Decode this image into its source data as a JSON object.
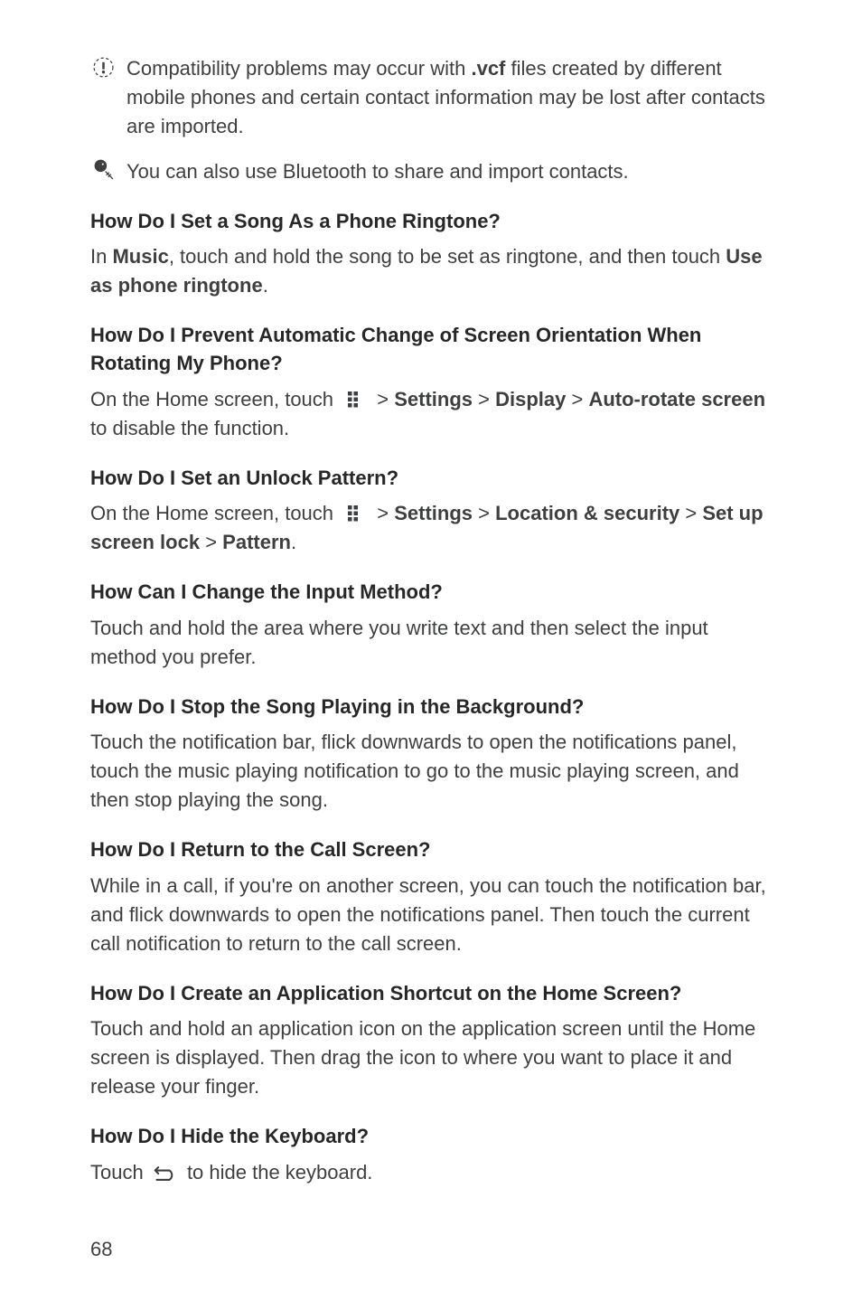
{
  "callouts": {
    "warning": {
      "pre": "Compatibility problems may occur with ",
      "vcf": ".vcf",
      "post": " files created by different mobile phones and certain contact information may be lost after contacts are imported."
    },
    "tip": {
      "text": "You can also use Bluetooth to share and import contacts."
    }
  },
  "sections": [
    {
      "title": "How Do I Set a Song As a Phone Ringtone?",
      "parts": [
        {
          "text": "In "
        },
        {
          "text": "Music",
          "bold": true
        },
        {
          "text": ", touch and hold the song to be set as ringtone, and then touch "
        },
        {
          "text": "Use as phone ringtone",
          "bold": true
        },
        {
          "text": "."
        }
      ]
    },
    {
      "title": "How Do I Prevent Automatic Change of Screen Orientation When Rotating My Phone?",
      "parts": [
        {
          "text": "On the Home screen, touch "
        },
        {
          "icon": "apps"
        },
        {
          "text": " > "
        },
        {
          "text": "Settings",
          "bold": true
        },
        {
          "text": " > "
        },
        {
          "text": "Display",
          "bold": true
        },
        {
          "text": " > "
        },
        {
          "text": "Auto-rotate screen",
          "bold": true
        },
        {
          "text": " to disable the function."
        }
      ]
    },
    {
      "title": "How Do I Set an Unlock Pattern?",
      "parts": [
        {
          "text": "On the Home screen, touch "
        },
        {
          "icon": "apps"
        },
        {
          "text": " > "
        },
        {
          "text": "Settings",
          "bold": true
        },
        {
          "text": " > "
        },
        {
          "text": "Location & security",
          "bold": true
        },
        {
          "text": " > "
        },
        {
          "text": "Set up screen lock",
          "bold": true
        },
        {
          "text": " > "
        },
        {
          "text": "Pattern",
          "bold": true
        },
        {
          "text": "."
        }
      ]
    },
    {
      "title": "How Can I Change the Input Method?",
      "parts": [
        {
          "text": "Touch and hold the area where you write text and then select the input method you prefer."
        }
      ]
    },
    {
      "title": "How Do I Stop the Song Playing in the Background?",
      "parts": [
        {
          "text": "Touch the notification bar, flick downwards to open the notifications panel, touch the music playing notification to go to the music playing screen, and then stop playing the song."
        }
      ]
    },
    {
      "title": "How Do I Return to the Call Screen?",
      "parts": [
        {
          "text": "While in a call, if you're on another screen, you can touch the notification bar, and flick downwards to open the notifications panel. Then touch the current call notification to return to the call screen."
        }
      ]
    },
    {
      "title": "How Do I Create an Application Shortcut on the Home Screen?",
      "parts": [
        {
          "text": "Touch and hold an application icon on the application screen until the Home screen is displayed. Then drag the icon to where you want to place it and release your finger."
        }
      ]
    },
    {
      "title": "How Do I Hide the Keyboard?",
      "parts": [
        {
          "text": "Touch "
        },
        {
          "icon": "back"
        },
        {
          "text": " to hide the keyboard."
        }
      ]
    }
  ],
  "pageNumber": "68"
}
